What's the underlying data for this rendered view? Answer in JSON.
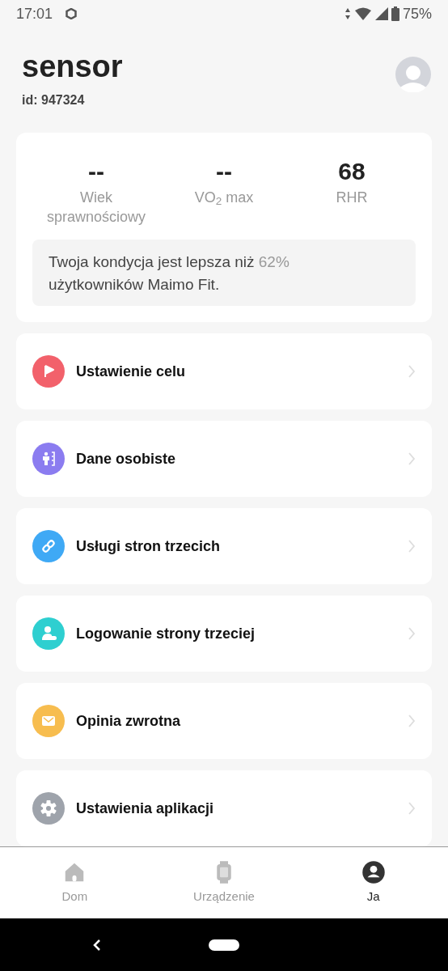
{
  "status_bar": {
    "time": "17:01",
    "battery": "75%"
  },
  "profile": {
    "name": "sensor",
    "id": "id: 947324"
  },
  "stats": [
    {
      "value": "--",
      "label": "Wiek sprawnościowy"
    },
    {
      "value": "--",
      "label": "VO$_{2}$ max"
    },
    {
      "value": "68",
      "label": "RHR"
    }
  ],
  "message": [
    {
      "text": "Twoja kondycja jest lepsza niż ",
      "kind": "normal"
    },
    {
      "text": "62%",
      "kind": "highlight"
    },
    {
      "text": " użytkowników Maimo Fit.",
      "kind": "normal"
    }
  ],
  "menu": [
    {
      "label": "Ustawienie celu",
      "kind": "flag",
      "color": "#f2616b"
    },
    {
      "label": "Dane osobiste",
      "kind": "person",
      "color": "#8b7cf0"
    },
    {
      "label": "Usługi stron trzecich",
      "kind": "link",
      "color": "#3fa9f5"
    },
    {
      "label": "Logowanie strony trzeciej",
      "kind": "login",
      "color": "#2ecfd0"
    },
    {
      "label": "Opinia zwrotna",
      "kind": "mail",
      "color": "#f7bd4f"
    },
    {
      "label": "Ustawienia aplikacji",
      "kind": "gear",
      "color": "#9ea3ab"
    }
  ],
  "tabs": [
    {
      "label": "Dom",
      "kind": "home",
      "selected": false
    },
    {
      "label": "Urządzenie",
      "kind": "watch",
      "selected": false
    },
    {
      "label": "Ja",
      "kind": "me",
      "selected": true
    }
  ]
}
